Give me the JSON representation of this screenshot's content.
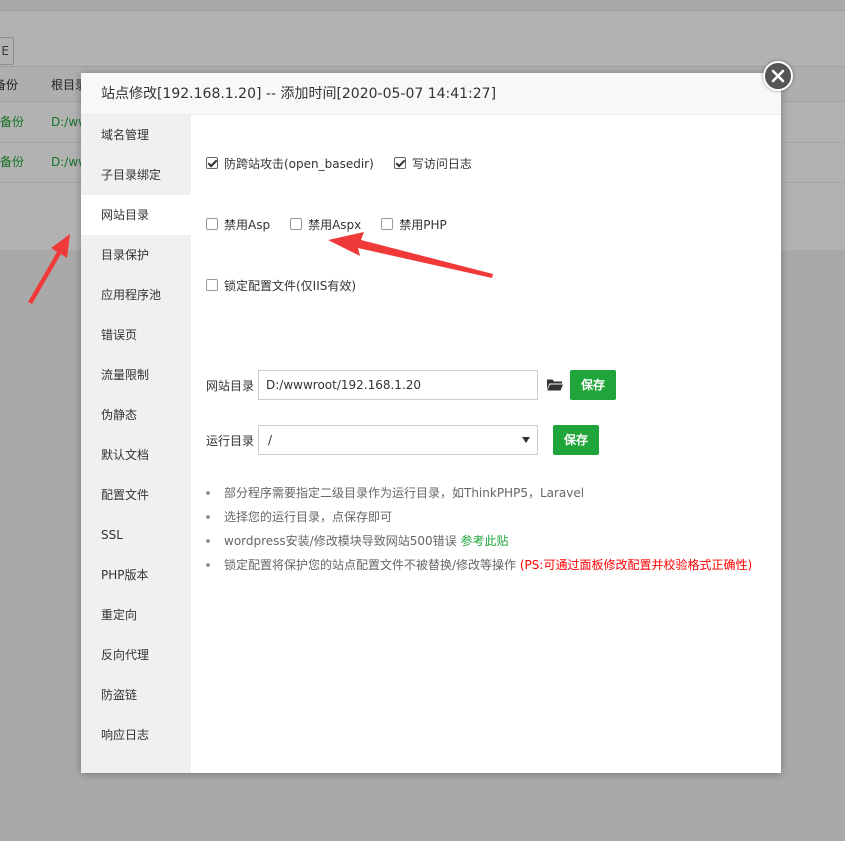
{
  "background": {
    "button_label": "E",
    "table_headers": [
      "备份",
      "根目录"
    ],
    "rows": [
      {
        "backup": "无备份",
        "path": "D:/ww"
      },
      {
        "backup": "有备份",
        "path": "D:/ww"
      }
    ]
  },
  "modal": {
    "title": "站点修改[192.168.1.20] -- 添加时间[2020-05-07 14:41:27]"
  },
  "sidebar": {
    "items": [
      {
        "label": "域名管理"
      },
      {
        "label": "子目录绑定"
      },
      {
        "label": "网站目录"
      },
      {
        "label": "目录保护"
      },
      {
        "label": "应用程序池"
      },
      {
        "label": "错误页"
      },
      {
        "label": "流量限制"
      },
      {
        "label": "伪静态"
      },
      {
        "label": "默认文档"
      },
      {
        "label": "配置文件"
      },
      {
        "label": "SSL"
      },
      {
        "label": "PHP版本"
      },
      {
        "label": "重定向"
      },
      {
        "label": "反向代理"
      },
      {
        "label": "防盗链"
      },
      {
        "label": "响应日志"
      }
    ],
    "active_index": 2
  },
  "options": {
    "anti_cross_site": {
      "label": "防跨站攻击(open_basedir)",
      "checked": true
    },
    "access_log": {
      "label": "写访问日志",
      "checked": true
    },
    "disable_asp": {
      "label": "禁用Asp",
      "checked": false
    },
    "disable_aspx": {
      "label": "禁用Aspx",
      "checked": false
    },
    "disable_php": {
      "label": "禁用PHP",
      "checked": false
    },
    "lock_config": {
      "label": "锁定配置文件(仅IIS有效)",
      "checked": false
    }
  },
  "site_dir": {
    "label": "网站目录",
    "value": "D:/wwwroot/192.168.1.20",
    "save_label": "保存"
  },
  "run_dir": {
    "label": "运行目录",
    "value": "/",
    "save_label": "保存"
  },
  "tips": {
    "tip1": "部分程序需要指定二级目录作为运行目录，如ThinkPHP5，Laravel",
    "tip2": "选择您的运行目录，点保存即可",
    "tip3_text": "wordpress安装/修改模块导致网站500错误 ",
    "tip3_link": "参考此贴",
    "tip4_text": "锁定配置将保护您的站点配置文件不被替换/修改等操作 ",
    "tip4_red": "(PS:可通过面板修改配置并校验格式正确性)"
  },
  "colors": {
    "accent": "#20a53a",
    "warning": "#ff0000",
    "annotation_arrow": "#f03a3a"
  },
  "icons": {
    "close": "close-icon",
    "folder": "folder-open-icon",
    "caret": "chevron-down-icon"
  }
}
